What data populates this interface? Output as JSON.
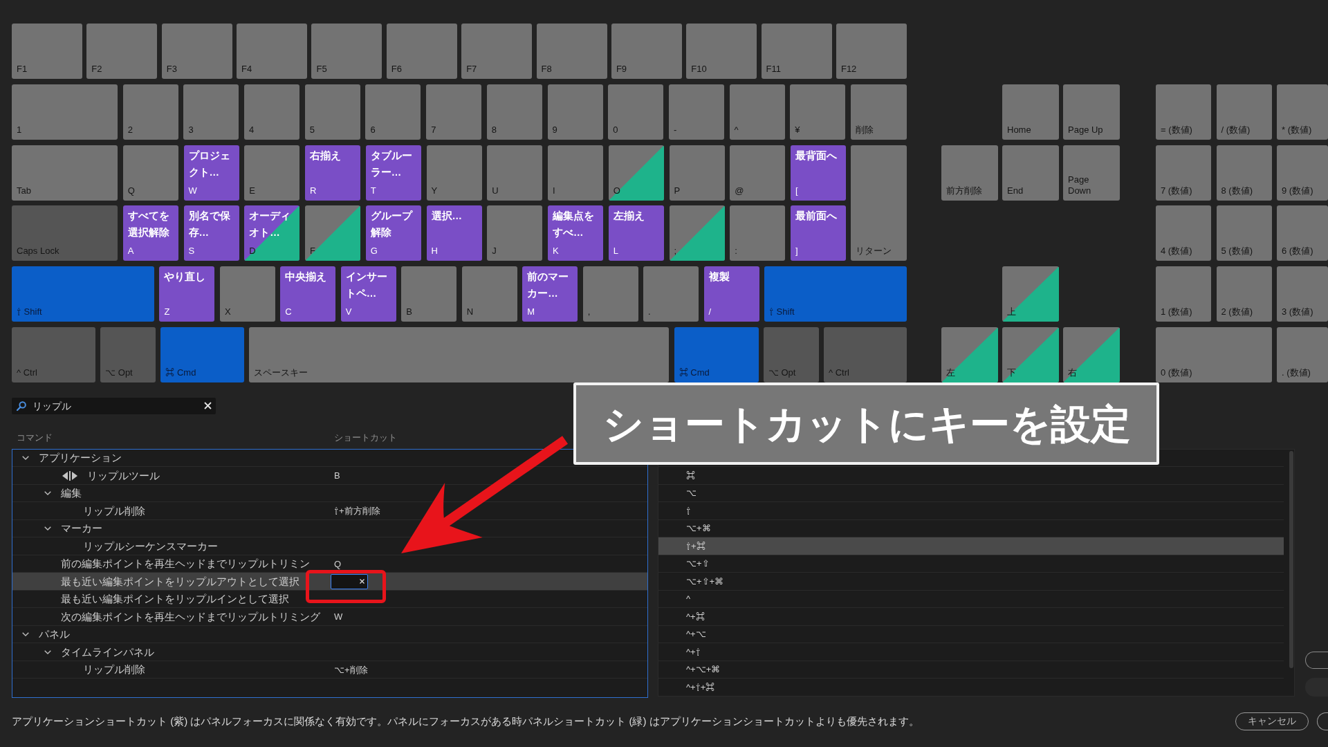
{
  "keyboard": {
    "rows": [
      [
        {
          "label": "F1",
          "kind": "plain"
        },
        {
          "label": "F2",
          "kind": "plain"
        },
        {
          "label": "F3",
          "kind": "plain"
        },
        {
          "label": "F4",
          "kind": "plain"
        },
        {
          "label": "F5",
          "kind": "plain"
        },
        {
          "label": "F6",
          "kind": "plain"
        },
        {
          "label": "F7",
          "kind": "plain"
        },
        {
          "label": "F8",
          "kind": "plain"
        },
        {
          "label": "F9",
          "kind": "plain"
        },
        {
          "label": "F10",
          "kind": "plain"
        },
        {
          "label": "F11",
          "kind": "plain"
        },
        {
          "label": "F12",
          "kind": "plain"
        }
      ],
      [
        {
          "label": "1",
          "kind": "plain"
        },
        {
          "label": "2",
          "kind": "plain"
        },
        {
          "label": "3",
          "kind": "plain"
        },
        {
          "label": "4",
          "kind": "plain"
        },
        {
          "label": "5",
          "kind": "plain"
        },
        {
          "label": "6",
          "kind": "plain"
        },
        {
          "label": "7",
          "kind": "plain"
        },
        {
          "label": "8",
          "kind": "plain"
        },
        {
          "label": "9",
          "kind": "plain"
        },
        {
          "label": "0",
          "kind": "plain"
        },
        {
          "label": "-",
          "kind": "plain"
        },
        {
          "label": "^",
          "kind": "plain"
        },
        {
          "label": "¥",
          "kind": "plain"
        },
        {
          "label": "削除",
          "kind": "plain"
        }
      ],
      [
        {
          "label": "Tab",
          "kind": "plain"
        },
        {
          "label": "Q",
          "kind": "plain"
        },
        {
          "label": "W",
          "kind": "app",
          "command": "プロジェクト…"
        },
        {
          "label": "E",
          "kind": "plain"
        },
        {
          "label": "R",
          "kind": "app",
          "command": "右揃え"
        },
        {
          "label": "T",
          "kind": "app",
          "command": "タブルーラー…"
        },
        {
          "label": "Y",
          "kind": "plain"
        },
        {
          "label": "U",
          "kind": "plain"
        },
        {
          "label": "I",
          "kind": "plain"
        },
        {
          "label": "O",
          "kind": "panel"
        },
        {
          "label": "P",
          "kind": "plain"
        },
        {
          "label": "@",
          "kind": "plain"
        },
        {
          "label": "[",
          "kind": "app",
          "command": "最背面へ"
        }
      ],
      [
        {
          "label": "Caps Lock",
          "kind": "modifier"
        },
        {
          "label": "A",
          "kind": "app",
          "command": "すべてを選択解除"
        },
        {
          "label": "S",
          "kind": "app",
          "command": "別名で保存…"
        },
        {
          "label": "D",
          "kind": "app_panel",
          "command": "オーディオト…"
        },
        {
          "label": "F",
          "kind": "panel"
        },
        {
          "label": "G",
          "kind": "app",
          "command": "グループ解除"
        },
        {
          "label": "H",
          "kind": "app",
          "command": "選択…"
        },
        {
          "label": "J",
          "kind": "plain"
        },
        {
          "label": "K",
          "kind": "app",
          "command": "編集点をすべ…"
        },
        {
          "label": "L",
          "kind": "app",
          "command": "左揃え"
        },
        {
          "label": ";",
          "kind": "panel"
        },
        {
          "label": ":",
          "kind": "plain"
        },
        {
          "label": "]",
          "kind": "app",
          "command": "最前面へ"
        }
      ],
      [
        {
          "label": "⇧ Shift",
          "kind": "modifier_held"
        },
        {
          "label": "Z",
          "kind": "app",
          "command": "やり直し"
        },
        {
          "label": "X",
          "kind": "plain"
        },
        {
          "label": "C",
          "kind": "app",
          "command": "中央揃え"
        },
        {
          "label": "V",
          "kind": "app",
          "command": "インサートペ…"
        },
        {
          "label": "B",
          "kind": "plain"
        },
        {
          "label": "N",
          "kind": "plain"
        },
        {
          "label": "M",
          "kind": "app",
          "command": "前のマーカー…"
        },
        {
          "label": ",",
          "kind": "plain"
        },
        {
          "label": ".",
          "kind": "plain"
        },
        {
          "label": "/",
          "kind": "app",
          "command": "複製"
        },
        {
          "label": "⇧ Shift",
          "kind": "modifier_held"
        }
      ],
      [
        {
          "label": "^ Ctrl",
          "kind": "modifier"
        },
        {
          "label": "⌥ Opt",
          "kind": "modifier"
        },
        {
          "label": "⌘ Cmd",
          "kind": "modifier_held"
        },
        {
          "label": "スペースキー",
          "kind": "plain"
        },
        {
          "label": "⌘ Cmd",
          "kind": "modifier_held"
        },
        {
          "label": "⌥ Opt",
          "kind": "modifier"
        },
        {
          "label": "^ Ctrl",
          "kind": "modifier"
        }
      ]
    ],
    "return_key": {
      "label": "リターン",
      "kind": "plain"
    }
  },
  "navigation": {
    "keys": [
      {
        "label": "Home",
        "kind": "plain"
      },
      {
        "label": "Page Up",
        "kind": "plain"
      },
      {
        "label": "前方削除",
        "kind": "plain"
      },
      {
        "label": "End",
        "kind": "plain"
      },
      {
        "label": "Page Down",
        "kind": "plain"
      },
      {
        "label": "上",
        "kind": "panel"
      },
      {
        "label": "左",
        "kind": "panel"
      },
      {
        "label": "下",
        "kind": "panel"
      },
      {
        "label": "右",
        "kind": "panel"
      }
    ]
  },
  "numpad": {
    "keys": [
      {
        "label": "= (数値)",
        "kind": "plain"
      },
      {
        "label": "/ (数値)",
        "kind": "plain"
      },
      {
        "label": "* (数値)",
        "kind": "plain"
      },
      {
        "label": "7 (数値)",
        "kind": "plain"
      },
      {
        "label": "8 (数値)",
        "kind": "plain"
      },
      {
        "label": "9 (数値)",
        "kind": "plain"
      },
      {
        "label": "4 (数値)",
        "kind": "plain"
      },
      {
        "label": "5 (数値)",
        "kind": "plain"
      },
      {
        "label": "6 (数値)",
        "kind": "plain"
      },
      {
        "label": "1 (数値)",
        "kind": "plain"
      },
      {
        "label": "2 (数値)",
        "kind": "plain"
      },
      {
        "label": "3 (数値)",
        "kind": "plain"
      },
      {
        "label": "0 (数値)",
        "kind": "plain"
      },
      {
        "label": ". (数値)",
        "kind": "plain"
      }
    ]
  },
  "search": {
    "value": "リップル"
  },
  "commands": {
    "columns": [
      "コマンド",
      "ショートカット"
    ],
    "tree": [
      {
        "label": "アプリケーション",
        "kind": "group",
        "expanded": true,
        "selected": false,
        "children": [
          {
            "label": "リップルツール",
            "kind": "tool",
            "shortcut": "B",
            "selected": false,
            "editing": false
          },
          {
            "label": "編集",
            "kind": "group",
            "expanded": true,
            "selected": false,
            "children": [
              {
                "label": "リップル削除",
                "kind": "command",
                "shortcut": "⇧+前方削除",
                "selected": false,
                "editing": false
              }
            ]
          },
          {
            "label": "マーカー",
            "kind": "group",
            "expanded": true,
            "selected": false,
            "children": [
              {
                "label": "リップルシーケンスマーカー",
                "kind": "command",
                "selected": false,
                "editing": false
              }
            ]
          },
          {
            "label": "前の編集ポイントを再生ヘッドまでリップルトリミン",
            "kind": "command",
            "shortcut": "Q",
            "selected": false,
            "editing": false
          },
          {
            "label": "最も近い編集ポイントをリップルアウトとして選択",
            "kind": "command",
            "selected": true,
            "editing": true
          },
          {
            "label": "最も近い編集ポイントをリップルインとして選択",
            "kind": "command",
            "selected": false,
            "editing": false
          },
          {
            "label": "次の編集ポイントを再生ヘッドまでリップルトリミング",
            "kind": "command",
            "shortcut": "W",
            "selected": false,
            "editing": false
          }
        ]
      },
      {
        "label": "パネル",
        "kind": "group",
        "expanded": true,
        "selected": false,
        "children": [
          {
            "label": "タイムラインパネル",
            "kind": "group",
            "expanded": true,
            "selected": false,
            "children": [
              {
                "label": "リップル削除",
                "kind": "command",
                "shortcut": "⌥+削除",
                "selected": false,
                "editing": false
              }
            ]
          }
        ]
      }
    ]
  },
  "modifiers": {
    "items": [
      {
        "label": "⌘",
        "selected": false
      },
      {
        "label": "⌥",
        "selected": false
      },
      {
        "label": "⇧",
        "selected": false
      },
      {
        "label": "⌥+⌘",
        "selected": false
      },
      {
        "label": "⇧+⌘",
        "selected": true
      },
      {
        "label": "⌥+⇧",
        "selected": false
      },
      {
        "label": "⌥+⇧+⌘",
        "selected": false
      },
      {
        "label": "^",
        "selected": false
      },
      {
        "label": "^+⌘",
        "selected": false
      },
      {
        "label": "^+⌥",
        "selected": false
      },
      {
        "label": "^+⇧",
        "selected": false
      },
      {
        "label": "^+⌥+⌘",
        "selected": false
      },
      {
        "label": "^+⇧+⌘",
        "selected": false
      }
    ]
  },
  "footer": {
    "note": "アプリケーションショートカット (紫) はパネルフォーカスに関係なく有効です。パネルにフォーカスがある時パネルショートカット (緑) はアプリケーションショートカットよりも優先されます。",
    "buttons": [
      "キャンセル"
    ]
  },
  "annotation": {
    "title": "ショートカットにキーを設定"
  }
}
